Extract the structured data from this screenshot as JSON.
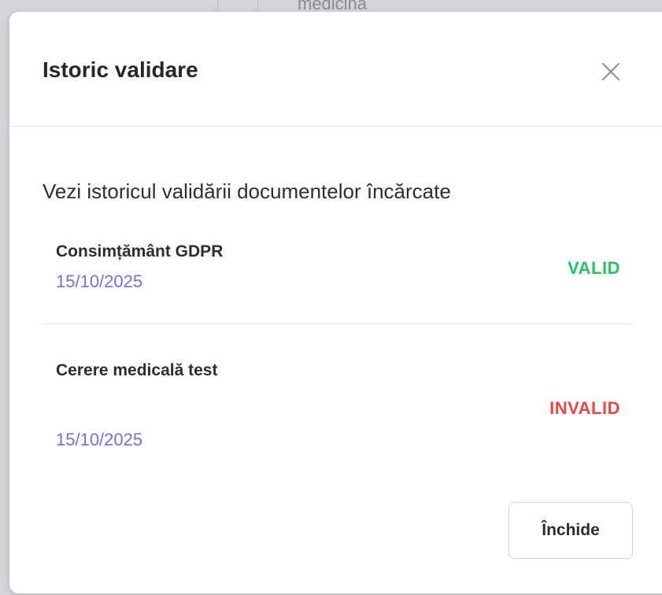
{
  "backdrop": {
    "partial_text": "medicină"
  },
  "modal": {
    "title": "Istoric validare",
    "close_icon": "close-icon",
    "description": "Vezi istoricul validării documentelor încărcate",
    "documents": [
      {
        "name": "Consimțământ GDPR",
        "date": "15/10/2025",
        "status": "VALID"
      },
      {
        "name": "Cerere medicală test",
        "date": "15/10/2025",
        "status": "INVALID"
      }
    ],
    "close_button_label": "Închide"
  },
  "colors": {
    "valid": "#22c55e",
    "invalid": "#ef4444",
    "date": "#6f6ff0",
    "text": "#2a2d32",
    "divider": "#e4e6ea"
  }
}
